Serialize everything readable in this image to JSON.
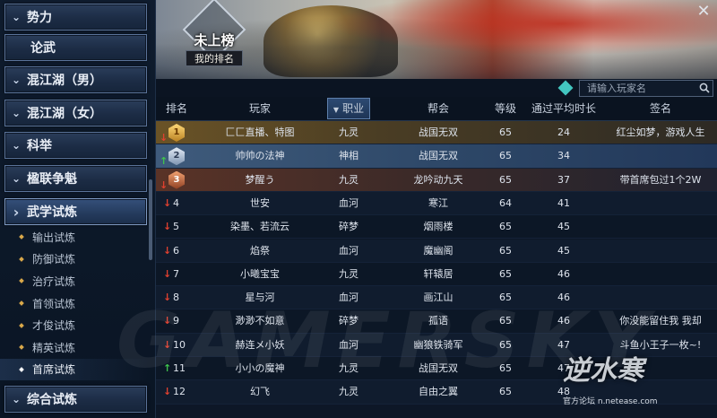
{
  "sidebar": {
    "categories": [
      {
        "label": "势力",
        "chevron": true
      },
      {
        "label": "论武",
        "chevron": false
      },
      {
        "label": "混江湖（男）",
        "chevron": true
      },
      {
        "label": "混江湖（女）",
        "chevron": true
      },
      {
        "label": "科举",
        "chevron": true
      },
      {
        "label": "楹联争魁",
        "chevron": true
      },
      {
        "label": "武学试炼",
        "chevron": true,
        "expanded": true
      },
      {
        "label": "综合试炼",
        "chevron": true
      }
    ],
    "subitems": [
      {
        "label": "输出试炼"
      },
      {
        "label": "防御试炼"
      },
      {
        "label": "治疗试炼"
      },
      {
        "label": "首领试炼"
      },
      {
        "label": "才俊试炼"
      },
      {
        "label": "精英试炼"
      },
      {
        "label": "首席试炼",
        "active": true
      }
    ]
  },
  "banner": {
    "rank_title": "未上榜",
    "rank_label": "我的排名",
    "close_icon": "close-icon"
  },
  "search": {
    "placeholder": "请输入玩家名"
  },
  "table": {
    "headers": {
      "rank": "排名",
      "player": "玩家",
      "class": "职业",
      "guild": "帮会",
      "level": "等级",
      "avg_time": "通过平均时长",
      "signature": "签名"
    },
    "sorted_column": "class",
    "rows": [
      {
        "rank": "1",
        "medal": "gold",
        "trend": "down",
        "player": "匚匚直播、特图",
        "class": "九灵",
        "guild": "战国无双",
        "level": "65",
        "avg_time": "24",
        "signature": "红尘如梦，游戏人生"
      },
      {
        "rank": "2",
        "medal": "silver",
        "trend": "up",
        "player": "帅帅の法神",
        "class": "神相",
        "guild": "战国无双",
        "level": "65",
        "avg_time": "34",
        "signature": ""
      },
      {
        "rank": "3",
        "medal": "bronze",
        "trend": "down",
        "player": "梦醒う",
        "class": "九灵",
        "guild": "龙吟动九天",
        "level": "65",
        "avg_time": "37",
        "signature": "带首席包过1个2W"
      },
      {
        "rank": "4",
        "trend": "down",
        "player": "世安",
        "class": "血河",
        "guild": "寒江",
        "level": "64",
        "avg_time": "41",
        "signature": ""
      },
      {
        "rank": "5",
        "trend": "down",
        "player": "染墨、若流云",
        "class": "碎梦",
        "guild": "烟雨楼",
        "level": "65",
        "avg_time": "45",
        "signature": ""
      },
      {
        "rank": "6",
        "trend": "down",
        "player": "焰祭",
        "class": "血河",
        "guild": "魔幽阁",
        "level": "65",
        "avg_time": "45",
        "signature": ""
      },
      {
        "rank": "7",
        "trend": "down",
        "player": "小曦宝宝",
        "class": "九灵",
        "guild": "轩辕居",
        "level": "65",
        "avg_time": "46",
        "signature": ""
      },
      {
        "rank": "8",
        "trend": "down",
        "player": "星与河",
        "class": "血河",
        "guild": "画江山",
        "level": "65",
        "avg_time": "46",
        "signature": ""
      },
      {
        "rank": "9",
        "trend": "down",
        "player": "渺渺不如意",
        "class": "碎梦",
        "guild": "孤语",
        "level": "65",
        "avg_time": "46",
        "signature": "你没能留住我 我却"
      },
      {
        "rank": "10",
        "trend": "down",
        "player": "赫连メ小妖",
        "class": "血河",
        "guild": "幽狼铁骑军",
        "level": "65",
        "avg_time": "47",
        "signature": "斗鱼小王子一枚~!"
      },
      {
        "rank": "11",
        "trend": "up",
        "player": "小小の魔神",
        "class": "九灵",
        "guild": "战国无双",
        "level": "65",
        "avg_time": "47",
        "signature": ""
      },
      {
        "rank": "12",
        "trend": "down",
        "player": "幻飞",
        "class": "九灵",
        "guild": "自由之翼",
        "level": "65",
        "avg_time": "48",
        "signature": ""
      }
    ]
  },
  "watermark": "GAMERSKY",
  "logo": {
    "mark": "逆水寒",
    "site": "官方论坛 n.netease.com"
  }
}
